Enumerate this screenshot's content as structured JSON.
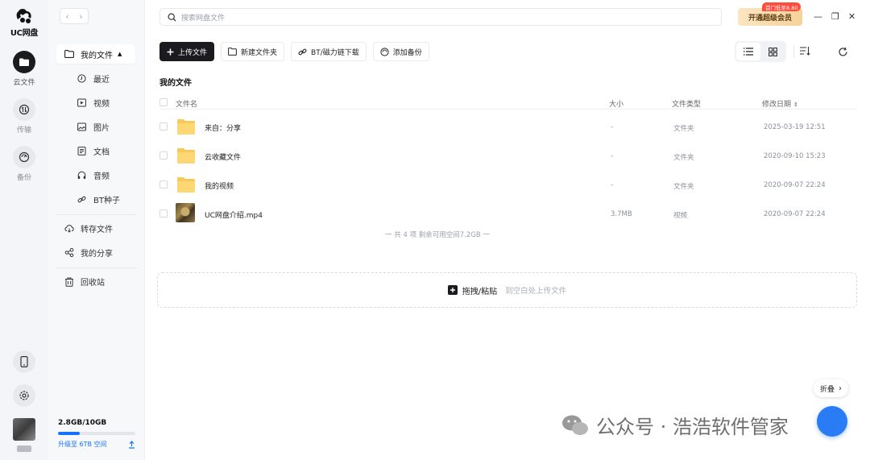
{
  "app": {
    "logo_text": "UC网盘"
  },
  "rail": {
    "items": [
      {
        "label": "云文件",
        "icon": "folder-icon",
        "active": true
      },
      {
        "label": "传输",
        "icon": "transfer-icon",
        "active": false
      },
      {
        "label": "备份",
        "icon": "backup-icon",
        "active": false
      }
    ],
    "bottom": [
      "phone-icon",
      "settings-icon",
      "avatar"
    ]
  },
  "sidebar": {
    "header": "我的文件",
    "sub_items": [
      {
        "label": "最近",
        "icon": "clock-icon"
      },
      {
        "label": "视频",
        "icon": "video-icon"
      },
      {
        "label": "图片",
        "icon": "image-icon"
      },
      {
        "label": "文档",
        "icon": "document-icon"
      },
      {
        "label": "音频",
        "icon": "headphones-icon"
      },
      {
        "label": "BT种子",
        "icon": "link-icon"
      }
    ],
    "main_items": [
      {
        "label": "转存文件",
        "icon": "cloud-save-icon"
      },
      {
        "label": "我的分享",
        "icon": "share-icon"
      },
      {
        "label": "回收站",
        "icon": "trash-icon"
      }
    ],
    "storage": {
      "used": "2.8GB/10GB",
      "fraction": 0.28,
      "upgrade": "升级至 6TB 空间"
    }
  },
  "search": {
    "placeholder": "搜索网盘文件"
  },
  "vip": {
    "label": "开通超级会员",
    "badge": "首门低至8.80"
  },
  "toolbar": {
    "upload": "上传文件",
    "new_folder": "新建文件夹",
    "bt_download": "BT/磁力链下载",
    "add_backup": "添加备份"
  },
  "page_title": "我的文件",
  "table": {
    "headers": {
      "name": "文件名",
      "size": "大小",
      "type": "文件类型",
      "date": "修改日期"
    },
    "rows": [
      {
        "name": "来自：分享",
        "size": "-",
        "type": "文件夹",
        "date": "2025-03-19 12:51",
        "kind": "folder"
      },
      {
        "name": "云收藏文件",
        "size": "-",
        "type": "文件夹",
        "date": "2020-09-10 15:23",
        "kind": "folder"
      },
      {
        "name": "我的视频",
        "size": "-",
        "type": "文件夹",
        "date": "2020-09-07 22:24",
        "kind": "folder"
      },
      {
        "name": "UC网盘介绍.mp4",
        "size": "3.7MB",
        "type": "视频",
        "date": "2020-09-07 22:24",
        "kind": "video"
      }
    ],
    "summary": "一 共 4 项 剩余可用空间7.2GB 一"
  },
  "dropzone": {
    "main": "拖拽/粘贴",
    "hint": "到空白处上传文件"
  },
  "collapse": {
    "label": "折叠"
  },
  "watermark": {
    "text": "公众号 · 浩浩软件管家"
  }
}
